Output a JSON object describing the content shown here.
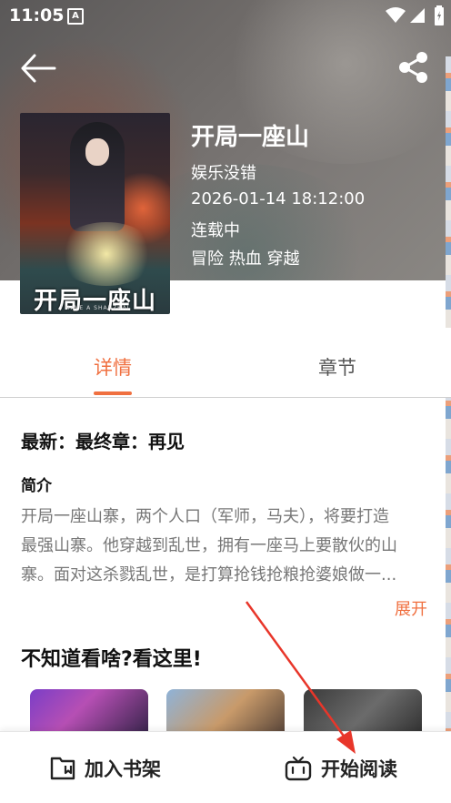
{
  "status_bar": {
    "time": "11:05",
    "notif_badge": "A"
  },
  "header": {
    "back_icon": "arrow-left-icon",
    "share_icon": "share-icon"
  },
  "book": {
    "cover_title": "开局一座山",
    "cover_subtitle": "I HAVE A SHANZHAI",
    "title": "开局一座山",
    "author": "娱乐没错",
    "updated": "2026-01-14 18:12:00",
    "status": "连载中",
    "tags": "冒险 热血 穿越"
  },
  "tabs": [
    {
      "label": "详情",
      "active": true
    },
    {
      "label": "章节",
      "active": false
    }
  ],
  "detail": {
    "latest": "最新：最终章：再见",
    "intro_heading": "简介",
    "intro_lines": [
      "开局一座山寨，两个人口（军师，马夫），将要打造",
      "最强山寨。他穿越到乱世，拥有一座马上要散伙的山",
      "寨。面对这杀戮乱世，是打算抢钱抢粮抢婆娘做一..."
    ],
    "expand_label": "展开"
  },
  "recommend": {
    "heading": "不知道看啥?看这里!"
  },
  "bottom_bar": {
    "shelf_label": "加入书架",
    "read_label": "开始阅读"
  },
  "colors": {
    "accent": "#f07040",
    "annotation_arrow": "#e8362a"
  }
}
